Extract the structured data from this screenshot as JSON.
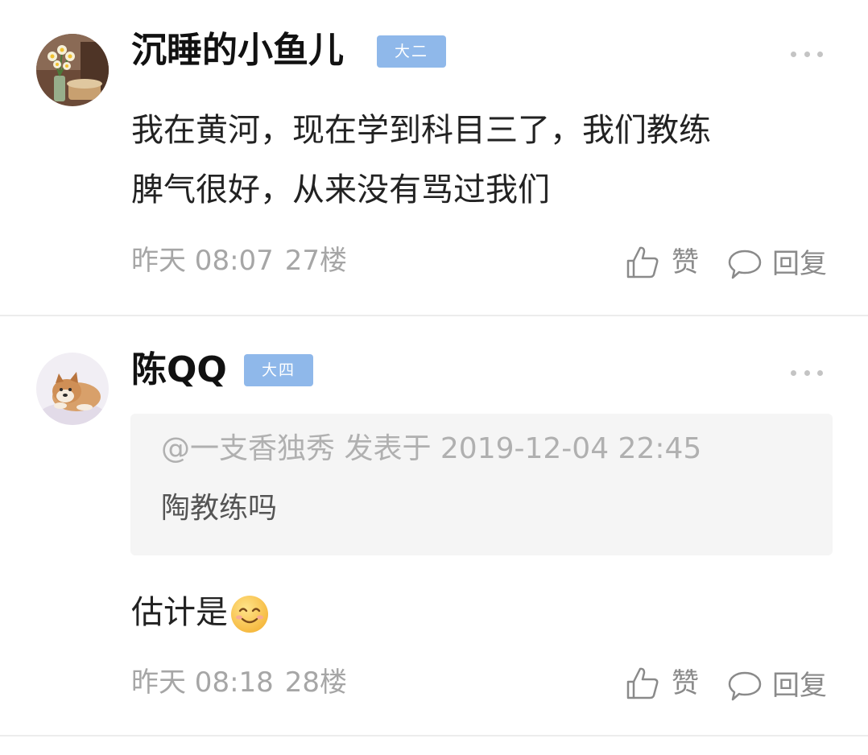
{
  "colors": {
    "badge": "#8fb8ea",
    "divider": "#ececec",
    "meta_text": "#a6a6a6",
    "quote_bg": "#f5f5f5"
  },
  "posts": [
    {
      "username": "沉睡的小鱼儿",
      "badge": "大二",
      "avatar": "flower-vase-avatar",
      "content_lines": [
        "我在黄河，现在学到科目三了，我们教练",
        "脾气很好，从来没有骂过我们"
      ],
      "time": "昨天 08:07",
      "floor": "27楼",
      "like_label": "赞",
      "reply_label": "回复"
    },
    {
      "username": "陈QQ",
      "badge": "大四",
      "avatar": "shiba-dog-avatar",
      "quote": {
        "header": "@一支香独秀 发表于 2019-12-04 22:45",
        "text": "陶教练吗"
      },
      "content": "估计是",
      "emoji": "smiling-face-emoji",
      "time": "昨天 08:18",
      "floor": "28楼",
      "like_label": "赞",
      "reply_label": "回复"
    }
  ]
}
